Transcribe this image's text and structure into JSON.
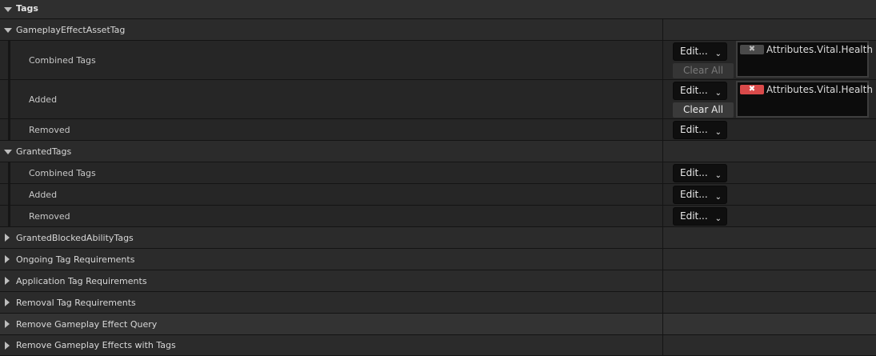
{
  "section_title": "Tags",
  "gameplay_effect_asset_tag": {
    "label": "GameplayEffectAssetTag",
    "combined": {
      "label": "Combined Tags",
      "edit": "Edit...",
      "clear": "Clear All",
      "tag": "Attributes.Vital.Health"
    },
    "added": {
      "label": "Added",
      "edit": "Edit...",
      "clear": "Clear All",
      "tag": "Attributes.Vital.Health"
    },
    "removed": {
      "label": "Removed",
      "edit": "Edit..."
    }
  },
  "granted_tags": {
    "label": "GrantedTags",
    "combined": {
      "label": "Combined Tags",
      "edit": "Edit..."
    },
    "added": {
      "label": "Added",
      "edit": "Edit..."
    },
    "removed": {
      "label": "Removed",
      "edit": "Edit..."
    }
  },
  "collapsed_categories": [
    "GrantedBlockedAbilityTags",
    "Ongoing Tag Requirements",
    "Application Tag Requirements",
    "Removal Tag Requirements",
    "Remove Gameplay Effect Query",
    "Remove Gameplay Effects with Tags"
  ],
  "icons": {
    "expanded": "triangle-down",
    "collapsed": "triangle-right",
    "dropdown": "chevron-down",
    "remove_tag": "x-mark"
  },
  "colors": {
    "remove_tag_active": "#d94a4a",
    "remove_tag_inactive": "#4a4a4a"
  }
}
